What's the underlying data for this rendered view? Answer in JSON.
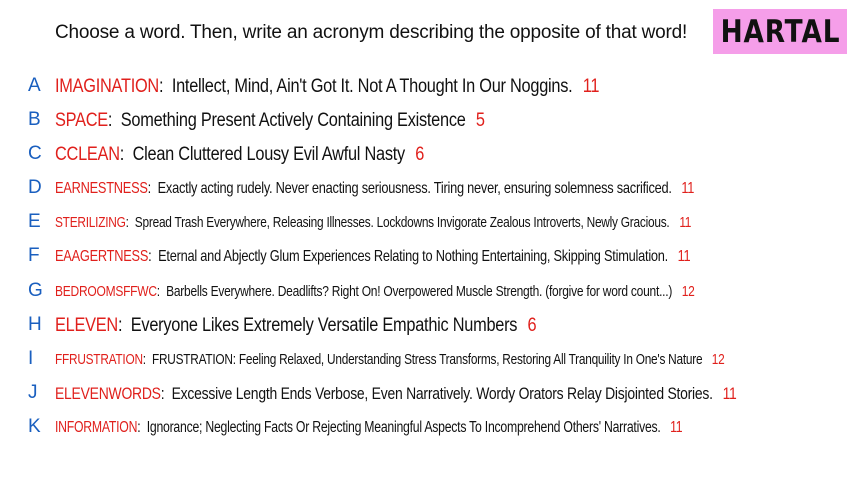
{
  "header": {
    "prompt": "Choose a word. Then, write an acronym describing the opposite of that word!",
    "logo": "HARTAL"
  },
  "colors": {
    "word": "#e0201c",
    "count": "#e0201c",
    "letter": "#1a5fbf",
    "logo_bg": "#f59ee9"
  },
  "entries": [
    {
      "letter": "A",
      "word": "IMAGINATION",
      "acronym": "Intellect, Mind, Ain't Got It. Not A Thought In Our Noggins.",
      "count": "11"
    },
    {
      "letter": "B",
      "word": "SPACE",
      "acronym": "Something Present Actively Containing Existence",
      "count": "5"
    },
    {
      "letter": "C",
      "word": "CCLEAN",
      "acronym": "Clean Cluttered Lousy Evil Awful Nasty",
      "count": "6"
    },
    {
      "letter": "D",
      "word": "EARNESTNESS",
      "acronym": "Exactly acting rudely. Never enacting seriousness. Tiring never, ensuring solemness sacrificed.",
      "count": "11"
    },
    {
      "letter": "E",
      "word": "STERILIZING",
      "acronym": "Spread Trash Everywhere, Releasing Illnesses. Lockdowns Invigorate Zealous Introverts, Newly Gracious.",
      "count": "11"
    },
    {
      "letter": "F",
      "word": "EAAGERTNESS",
      "acronym": "Eternal and Abjectly Glum Experiences Relating to Nothing Entertaining, Skipping Stimulation.",
      "count": "11"
    },
    {
      "letter": "G",
      "word": "BEDROOMSFFWC",
      "acronym": "Barbells Everywhere. Deadlifts? Right On! Overpowered Muscle Strength. (forgive for word count...)",
      "count": "12"
    },
    {
      "letter": "H",
      "word": "ELEVEN",
      "acronym": "Everyone Likes Extremely Versatile Empathic Numbers",
      "count": "6"
    },
    {
      "letter": "I",
      "word": "FFRUSTRATION",
      "acronym": "FRUSTRATION: Feeling Relaxed, Understanding Stress Transforms, Restoring All Tranquility In One's Nature",
      "count": "12"
    },
    {
      "letter": "J",
      "word": "ELEVENWORDS",
      "acronym": "Excessive Length Ends Verbose, Even Narratively. Wordy Orators Relay Disjointed Stories.",
      "count": "11"
    },
    {
      "letter": "K",
      "word": "INFORMATION",
      "acronym": "Ignorance; Neglecting Facts Or Rejecting Meaningful Aspects To Incomprehend Others' Narratives.",
      "count": "11"
    }
  ]
}
